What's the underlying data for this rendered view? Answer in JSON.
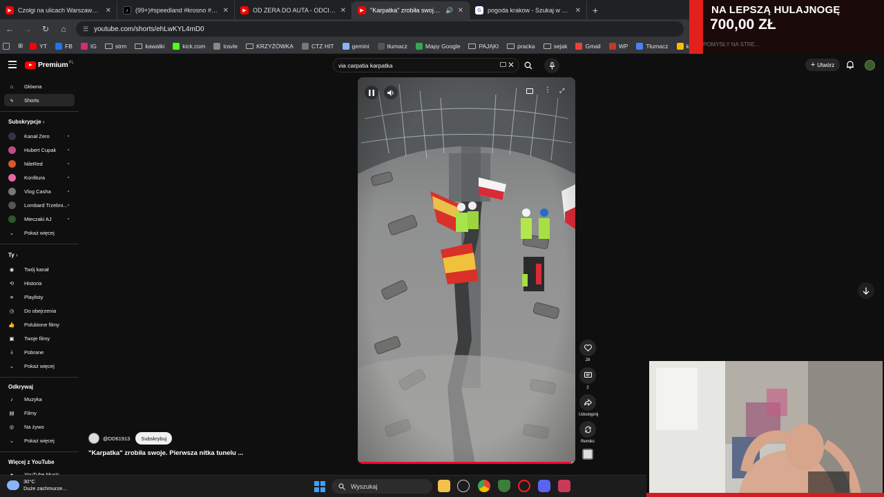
{
  "browser": {
    "tabs": [
      {
        "title": "Czołgi na ulicach Warszawy! Na",
        "icon": "youtube-icon",
        "color": "#ff0000"
      },
      {
        "title": "(99+)#speedland #krosno #bud",
        "icon": "tiktok-icon",
        "color": "#000000"
      },
      {
        "title": "OD ZERA DO AUTA - ODCINEK",
        "icon": "youtube-icon",
        "color": "#ff0000"
      },
      {
        "title": "\"Karpatka\" zrobiła swoje. Pi",
        "icon": "youtube-icon",
        "color": "#ff0000",
        "active": true
      },
      {
        "title": "pogoda krakow - Szukaj w Goo",
        "icon": "google-icon",
        "color": "#4285f4"
      }
    ],
    "new_tab": "+",
    "url": "youtube.com/shorts/ehLwKYL4mD0",
    "bookmarks": [
      {
        "label": "YT",
        "icon": "youtube-icon",
        "color": "#ff0000"
      },
      {
        "label": "FB",
        "icon": "facebook-icon",
        "color": "#1877f2"
      },
      {
        "label": "IG",
        "icon": "instagram-icon",
        "color": "#d62976"
      },
      {
        "label": "strm",
        "icon": "folder-icon"
      },
      {
        "label": "kawalki",
        "icon": "folder-icon"
      },
      {
        "label": "kick.com",
        "icon": "kick-icon",
        "color": "#53fc18"
      },
      {
        "label": "travle",
        "icon": "compass-icon",
        "color": "#888888"
      },
      {
        "label": "KRZYŻÓWKA",
        "icon": "folder-icon"
      },
      {
        "label": "CTZ HIT",
        "icon": "link-icon",
        "color": "#777777"
      },
      {
        "label": "gemini",
        "icon": "gemini-icon",
        "color": "#8ab4f8"
      },
      {
        "label": "tłumacz",
        "icon": "translate-icon",
        "color": "#555555"
      },
      {
        "label": "Mapy Google",
        "icon": "maps-icon",
        "color": "#34a853"
      },
      {
        "label": "PAJĄKI",
        "icon": "folder-icon"
      },
      {
        "label": "pracka",
        "icon": "folder-icon"
      },
      {
        "label": "sejak",
        "icon": "folder-icon"
      },
      {
        "label": "Gmail",
        "icon": "gmail-icon",
        "color": "#ea4335"
      },
      {
        "label": "WP",
        "icon": "wp-icon",
        "color": "#c0392b"
      },
      {
        "label": "Tłumacz",
        "icon": "translate-icon",
        "color": "#4285f4"
      },
      {
        "label": "ksiazka",
        "icon": "apps-icon",
        "color": "#fbbc04"
      }
    ]
  },
  "ad": {
    "line1": "NA LEPSZĄ HULAJNOGĘ",
    "line2": "700,00 ZŁ",
    "faint": "POMYSŁY NA STRE..."
  },
  "youtube": {
    "logo": "Premium",
    "logo_sup": "PL",
    "search_value": "via carpatia karpatka",
    "create_label": "Utwórz",
    "nav_main": [
      {
        "label": "Główna",
        "icon": "home-icon"
      },
      {
        "label": "Shorts",
        "icon": "shorts-icon",
        "active": true
      }
    ],
    "subs_heading": "Subskrypcje",
    "subscriptions": [
      {
        "label": "Kanał Zero",
        "color": "#333344"
      },
      {
        "label": "Hubert Cupak",
        "color": "#c24a8a"
      },
      {
        "label": "NileRed",
        "color": "#d9572b"
      },
      {
        "label": "Konfitura",
        "color": "#e46aa0"
      },
      {
        "label": "Vlog Casha",
        "color": "#777777"
      },
      {
        "label": "Lombard Trzebni...",
        "color": "#555555"
      },
      {
        "label": "Mieczaki AJ",
        "color": "#2a5a2a"
      }
    ],
    "show_more": "Pokaż więcej",
    "you_heading": "Ty",
    "you_items": [
      {
        "label": "Twój kanał",
        "icon": "channel-icon"
      },
      {
        "label": "Historia",
        "icon": "history-icon"
      },
      {
        "label": "Playlisty",
        "icon": "playlist-icon"
      },
      {
        "label": "Do obejrzenia",
        "icon": "clock-icon"
      },
      {
        "label": "Polubione filmy",
        "icon": "like-icon"
      },
      {
        "label": "Twoje filmy",
        "icon": "video-icon"
      },
      {
        "label": "Pobrane",
        "icon": "download-icon"
      },
      {
        "label": "Pokaż więcej",
        "icon": "chevron-down-icon"
      }
    ],
    "explore_heading": "Odkrywaj",
    "explore_items": [
      {
        "label": "Muzyka",
        "icon": "music-icon"
      },
      {
        "label": "Filmy",
        "icon": "film-icon"
      },
      {
        "label": "Na żywo",
        "icon": "live-icon"
      },
      {
        "label": "Pokaż więcej",
        "icon": "chevron-down-icon"
      }
    ],
    "more_heading": "Więcej z YouTube",
    "more_items": [
      {
        "label": "YouTube Music",
        "icon": "youtube-music-icon"
      }
    ]
  },
  "short": {
    "channel": "@DD61913",
    "subscribe_label": "Subskrybuj",
    "title": "\"Karpatka\" zrobiła swoje. Pierwsza nitka tunelu ...",
    "likes": "28",
    "comments": "2",
    "share_label": "Udostępnij",
    "remix_label": "Remiks",
    "progress": 0.98
  },
  "taskbar": {
    "temperature": "30°C",
    "weather": "Duże zachmurze...",
    "search_placeholder": "Wyszukaj"
  }
}
